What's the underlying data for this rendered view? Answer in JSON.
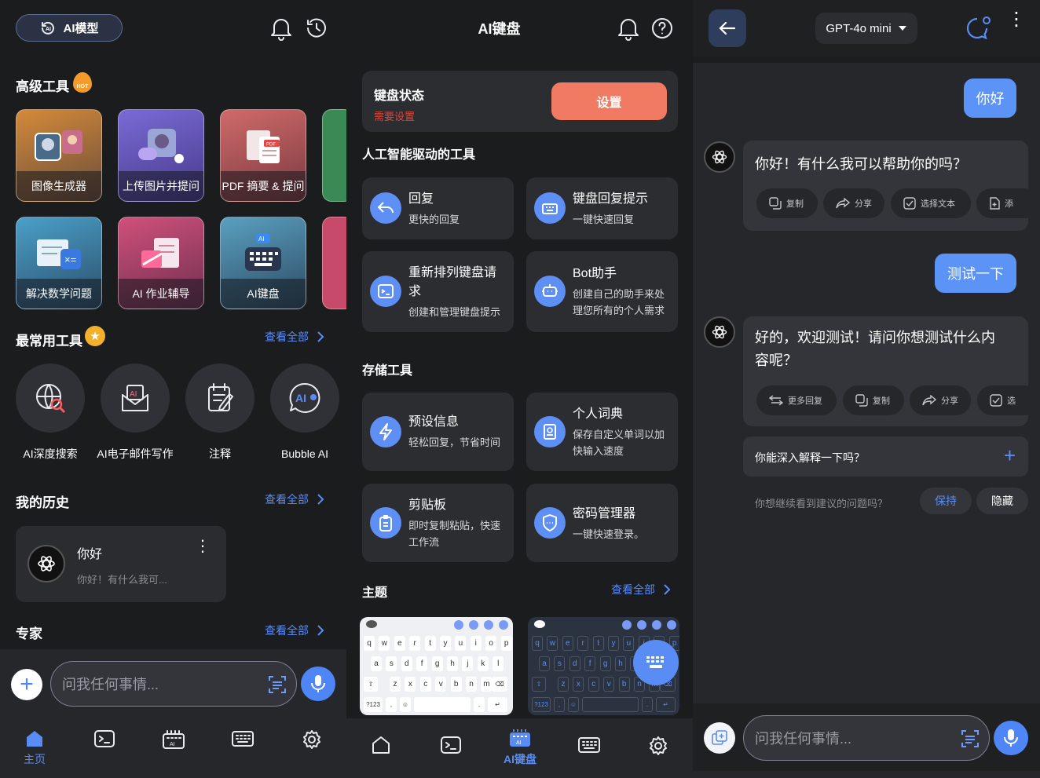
{
  "home": {
    "model_pill": "AI模型",
    "advanced_title": "高级工具",
    "hot_badge": "HOT",
    "tiles": [
      {
        "label": "图像生成器"
      },
      {
        "label": "上传图片并提问"
      },
      {
        "label": "PDF 摘要 & 提问"
      },
      {
        "label": "解决数学问题"
      },
      {
        "label": "AI 作业辅导"
      },
      {
        "label": "AI键盘"
      }
    ],
    "pdf_tag": "PDF",
    "ai_tag": "AI",
    "common_title": "最常用工具",
    "view_all": "查看全部",
    "common_tools": [
      {
        "label": "AI深度搜索"
      },
      {
        "label": "AI电子邮件写作"
      },
      {
        "label": "注释"
      },
      {
        "label": "Bubble AI"
      }
    ],
    "history_title": "我的历史",
    "history_item": {
      "title": "你好",
      "preview": "你好！有什么我可..."
    },
    "expert_title": "专家",
    "input_placeholder": "问我任何事情...",
    "nav": [
      {
        "label": "主页"
      },
      {
        "label": ""
      },
      {
        "label": ""
      },
      {
        "label": ""
      },
      {
        "label": ""
      }
    ]
  },
  "keyboard": {
    "title": "AI键盘",
    "status_title": "键盘状态",
    "status_sub": "需要设置",
    "settings_button": "设置",
    "ai_tools_title": "人工智能驱动的工具",
    "ai_cards": [
      {
        "title": "回复",
        "sub": "更快的回复"
      },
      {
        "title": "键盘回复提示",
        "sub": "一键快速回复"
      },
      {
        "title1": "重新排列键盘请",
        "title2": "求",
        "sub": "创建和管理键盘提示"
      },
      {
        "title": "Bot助手",
        "sub1": "创建自己的助手来处",
        "sub2": "理您所有的个人需求"
      }
    ],
    "storage_title": "存储工具",
    "storage_cards": [
      {
        "title": "预设信息",
        "sub": "轻松回复，节省时间"
      },
      {
        "title": "个人词典",
        "sub1": "保存自定义单词以加",
        "sub2": "快输入速度"
      },
      {
        "title": "剪贴板",
        "sub1": "即时复制粘贴，快速",
        "sub2": "工作流"
      },
      {
        "title": "密码管理器",
        "sub": "一键快速登录。"
      }
    ],
    "theme_title": "主题",
    "view_all": "查看全部",
    "kb_rows": [
      [
        "q",
        "w",
        "e",
        "r",
        "t",
        "y",
        "u",
        "i",
        "o",
        "p"
      ],
      [
        "a",
        "s",
        "d",
        "f",
        "g",
        "h",
        "j",
        "k",
        "l"
      ],
      [
        "z",
        "x",
        "c",
        "v",
        "b",
        "n",
        "m"
      ]
    ],
    "kb_123": "?123",
    "kb_comma": ",",
    "kb_dot": ".",
    "nav_active": "AI键盘",
    "colors": {
      "accent": "#5a8cf5",
      "settings": "#f07a62"
    }
  },
  "chat": {
    "model_select": "GPT-4o mini",
    "messages": [
      {
        "role": "user",
        "text": "你好"
      },
      {
        "role": "ai",
        "text": "你好！有什么我可以帮助你的吗？",
        "actions": [
          "复制",
          "分享",
          "选择文本",
          "添"
        ]
      },
      {
        "role": "user",
        "text": "测试一下"
      },
      {
        "role": "ai",
        "text1": "好的，欢迎测试！请问你想测试什么内",
        "text2": "容呢？",
        "actions": [
          "更多回复",
          "复制",
          "分享",
          "选"
        ]
      }
    ],
    "suggestion": "你能深入解释一下吗？",
    "continue_prompt": "你想继续看到建议的问题吗？",
    "keep_button": "保持",
    "hide_button": "隐藏",
    "input_placeholder": "问我任何事情..."
  }
}
